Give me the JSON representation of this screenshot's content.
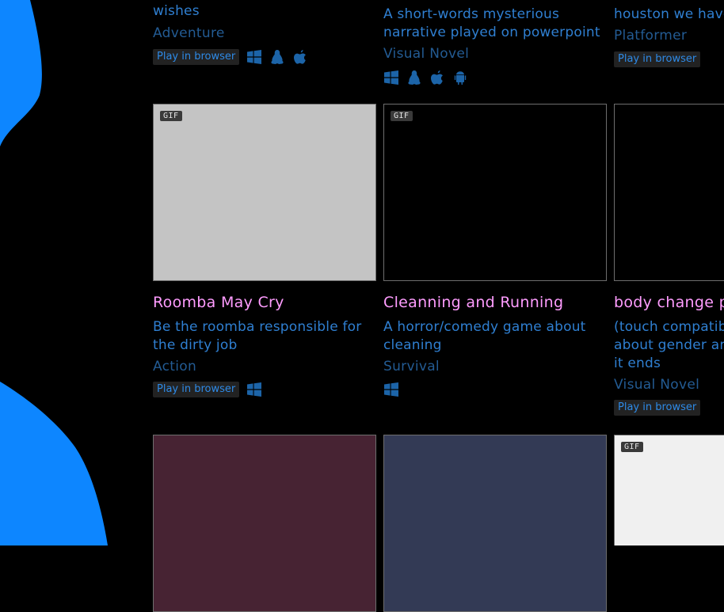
{
  "colors": {
    "background": "#000000",
    "blob": "#0d86ff",
    "title": "#ff9cff",
    "description": "#2f7fd1",
    "genre": "#235b93",
    "button_bg": "#222222",
    "button_text": "#2e8ae6",
    "icon": "#1c64a8"
  },
  "labels": {
    "play_in_browser": "Play in browser",
    "gif": "GIF"
  },
  "row_top": [
    {
      "desc_tail": "wishes",
      "genre": "Adventure",
      "browser": true,
      "platforms": [
        "windows-icon",
        "linux-icon",
        "apple-icon"
      ]
    },
    {
      "desc": "A short-words mysterious narrative played on powerpoint",
      "genre": "Visual Novel",
      "browser": false,
      "platforms": [
        "windows-icon",
        "linux-icon",
        "apple-icon",
        "android-icon"
      ]
    },
    {
      "desc": "houston we have",
      "genre": "Platformer",
      "browser": true,
      "platforms": []
    }
  ],
  "row_mid": [
    {
      "title": "Roomba May Cry",
      "desc": "Be the roomba responsible for the dirty job",
      "genre": "Action",
      "gif": true,
      "thumb_color": "#c4c4c4",
      "browser": true,
      "platforms": [
        "windows-icon"
      ]
    },
    {
      "title": "Cleanning and Running",
      "desc": "A horror/comedy game about cleaning",
      "genre": "Survival",
      "gif": true,
      "thumb_color": "#000000",
      "browser": false,
      "platforms": [
        "windows-icon"
      ]
    },
    {
      "title": "body change p",
      "desc": "(touch compatib about gender an it ends",
      "genre": "Visual Novel",
      "gif": false,
      "thumb_color": "#000000",
      "browser": true,
      "platforms": []
    }
  ],
  "row_bottom": [
    {
      "gif": false,
      "thumb_color": "#472333"
    },
    {
      "gif": false,
      "thumb_color": "#333a55"
    },
    {
      "gif": true,
      "thumb_color": "#f0f0f0"
    }
  ]
}
